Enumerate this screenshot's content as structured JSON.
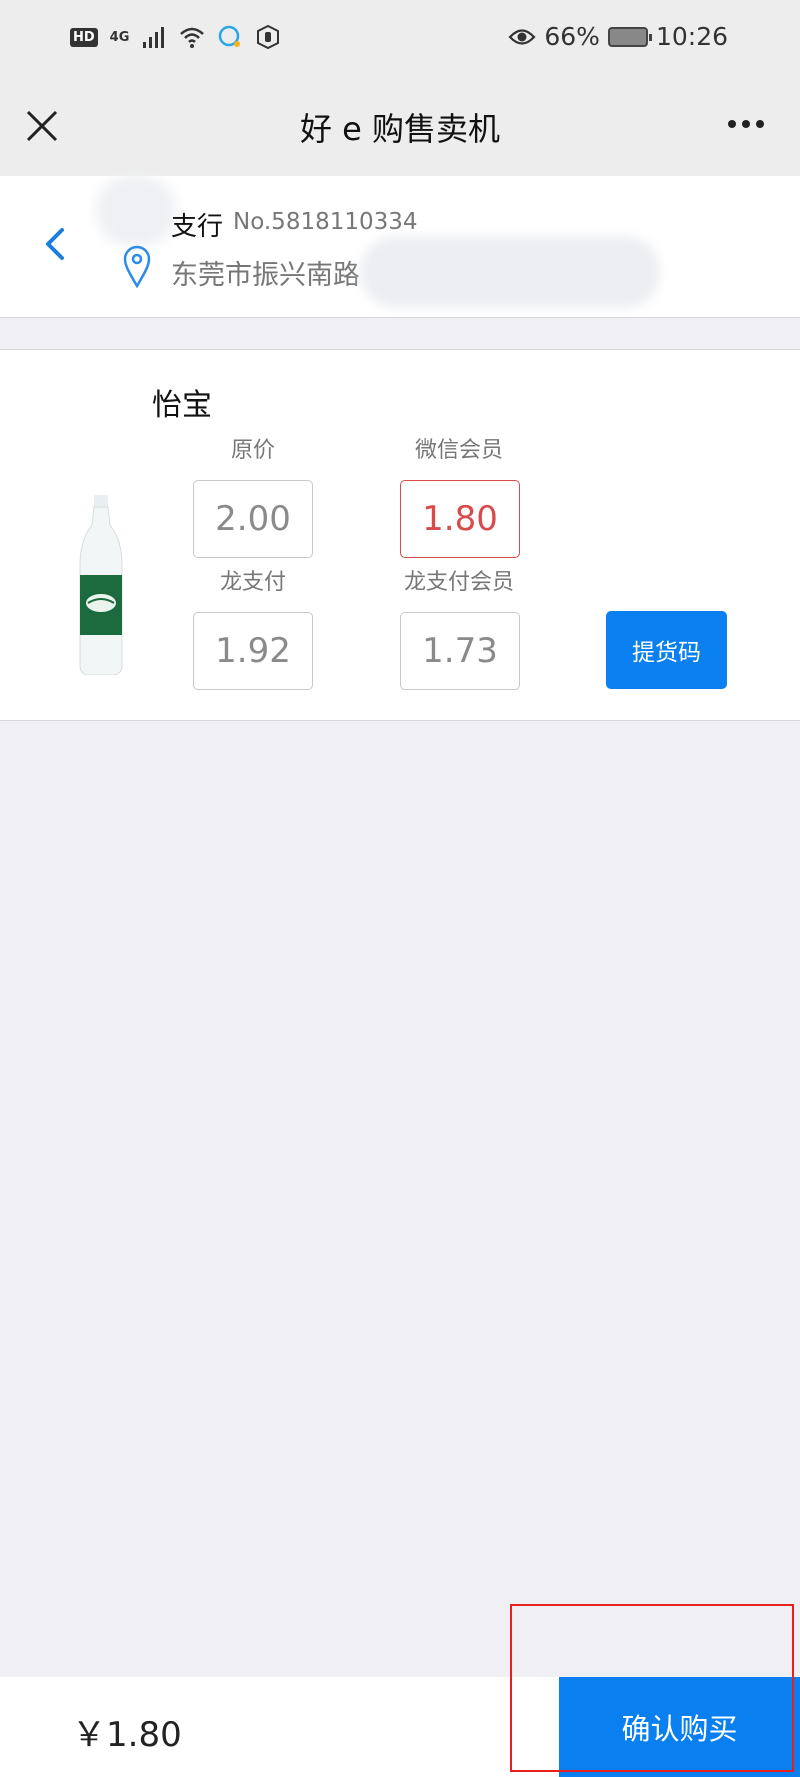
{
  "status_bar": {
    "hd": "HD",
    "network": "4G",
    "battery_percent": "66%",
    "time": "10:26"
  },
  "nav": {
    "title": "好 e 购售卖机"
  },
  "store": {
    "name": "支行",
    "number": "No.5818110334",
    "address": "东莞市振兴南路"
  },
  "product": {
    "name": "怡宝",
    "prices": [
      {
        "label": "原价",
        "value": "2.00",
        "active": false
      },
      {
        "label": "微信会员",
        "value": "1.80",
        "active": true
      },
      {
        "label": "龙支付",
        "value": "1.92",
        "active": false
      },
      {
        "label": "龙支付会员",
        "value": "1.73",
        "active": false
      }
    ],
    "pickup_label": "提货码"
  },
  "bottom": {
    "total": "￥1.80",
    "confirm_label": "确认购买"
  },
  "colors": {
    "accent": "#0a7fef",
    "active_price": "#d94a4a",
    "highlight": "#e81f1f"
  }
}
